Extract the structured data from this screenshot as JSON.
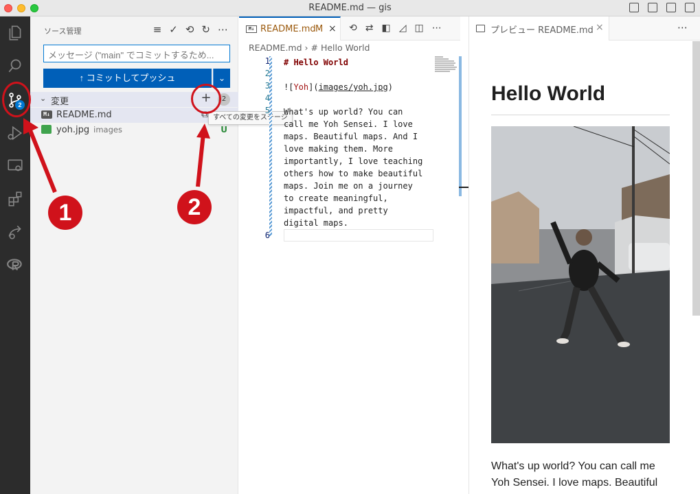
{
  "window": {
    "title": "README.md — gis"
  },
  "activity": {
    "scm_badge": "2"
  },
  "scm": {
    "title": "ソース管理",
    "message_placeholder": "メッセージ (\"main\" でコミットするため...",
    "commit_button": "↑ コミットしてプッシュ",
    "changes_label": "変更",
    "changes_count": "2",
    "stage_all_tooltip": "すべての変更をステージ",
    "files": [
      {
        "name": "README.md",
        "dir": "",
        "status": "M"
      },
      {
        "name": "yoh.jpg",
        "dir": "images",
        "status": "U"
      }
    ]
  },
  "editor": {
    "tab_label": "README.md",
    "tab_status": "M",
    "breadcrumb": [
      "README.md",
      "# Hello World"
    ],
    "line_numbers": [
      "1",
      "2",
      "3",
      "4",
      "5",
      "6"
    ],
    "code": {
      "heading": "# Hello World",
      "img_alt": "Yoh",
      "img_path": "images/yoh.jpg",
      "paragraph": [
        "What's up world? You can",
        "call me Yoh Sensei. I love",
        "maps. Beautiful maps. And I",
        "love making them. More",
        "importantly, I love teaching",
        "others how to make beautiful",
        "maps. Join me on a journey",
        "to create meaningful,",
        "impactful, and pretty",
        "digital maps."
      ]
    }
  },
  "preview": {
    "tab_label": "プレビュー README.md",
    "h1": "Hello World",
    "paragraph": "What's up world? You can call me Yoh Sensei. I love maps. Beautiful"
  },
  "annotations": {
    "one": "1",
    "two": "2"
  },
  "colors": {
    "accent": "#005fb8",
    "annotation_red": "#d0121b",
    "untracked_green": "#2e8b3c"
  }
}
